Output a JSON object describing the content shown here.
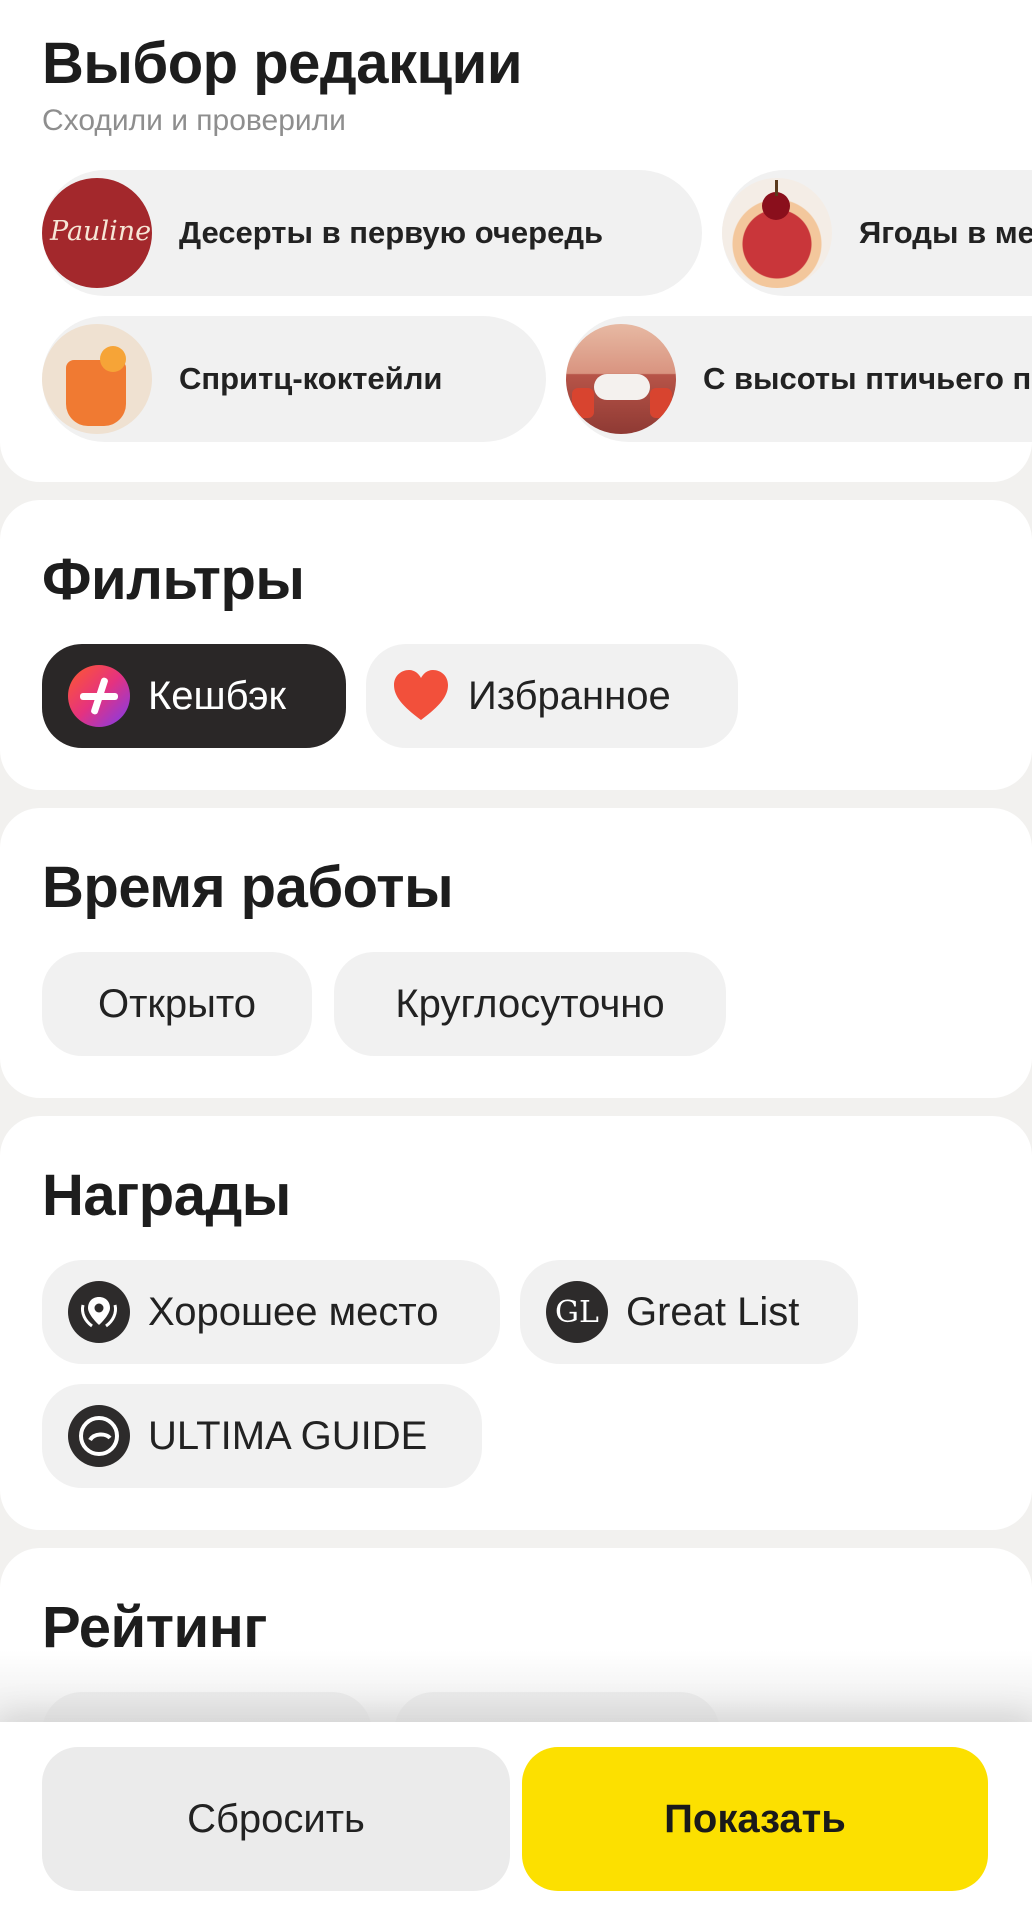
{
  "editorial": {
    "title": "Выбор редакции",
    "subtitle": "Сходили и проверили",
    "collections_row1": [
      {
        "label": "Десерты в первую очередь",
        "thumb_text": "Pauline",
        "icon": "pauline-logo"
      },
      {
        "label": "Ягоды в меню",
        "icon": "cherry-tart-photo"
      }
    ],
    "collections_row2": [
      {
        "label": "Спритц-коктейли",
        "icon": "spritz-cocktail-photo"
      },
      {
        "label": "С высоты птичьего полёта",
        "icon": "rooftop-restaurant-photo"
      }
    ]
  },
  "filters": {
    "title": "Фильтры",
    "cashback_label": "Кешбэк",
    "favorites_label": "Избранное"
  },
  "hours": {
    "title": "Время работы",
    "open_label": "Открыто",
    "allday_label": "Круглосуточно"
  },
  "awards": {
    "title": "Награды",
    "good_place_label": "Хорошее место",
    "great_list_label": "Great List",
    "great_list_icon_text": "GL",
    "ultima_label": "ULTIMA GUIDE"
  },
  "rating": {
    "title": "Рейтинг"
  },
  "actions": {
    "reset_label": "Сбросить",
    "show_label": "Показать"
  },
  "colors": {
    "accent_yellow": "#fce000",
    "chip_bg": "#f1f1f1",
    "dark_chip": "#2a2727",
    "heart_red": "#f2503b"
  }
}
